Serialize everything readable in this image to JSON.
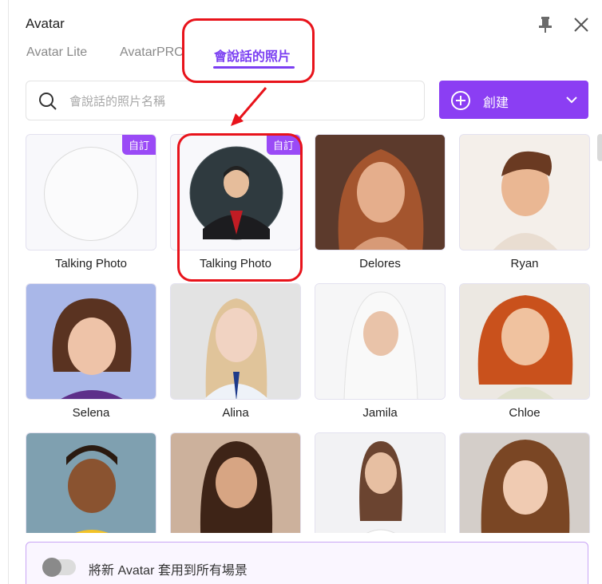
{
  "window": {
    "title": "Avatar"
  },
  "tabs": [
    {
      "label": "Avatar Lite"
    },
    {
      "label": "AvatarPRO"
    },
    {
      "label": "會說話的照片",
      "active": true
    }
  ],
  "search": {
    "placeholder": "會說話的照片名稱"
  },
  "create": {
    "label": "創建"
  },
  "badge_label": "自訂",
  "cards": [
    {
      "name": "Talking Photo",
      "badge": "自訂",
      "type": "empty"
    },
    {
      "name": "Talking Photo",
      "badge": "自訂",
      "type": "photo"
    },
    {
      "name": "Delores"
    },
    {
      "name": "Ryan"
    },
    {
      "name": "Selena"
    },
    {
      "name": "Alina"
    },
    {
      "name": "Jamila"
    },
    {
      "name": "Chloe"
    },
    {
      "name": ""
    },
    {
      "name": ""
    },
    {
      "name": ""
    },
    {
      "name": ""
    }
  ],
  "footer": {
    "toggle_label": "將新 Avatar 套用到所有場景",
    "toggle_on": false
  },
  "colors": {
    "accent": "#8b3ef3",
    "annotation": "#e8131b"
  }
}
